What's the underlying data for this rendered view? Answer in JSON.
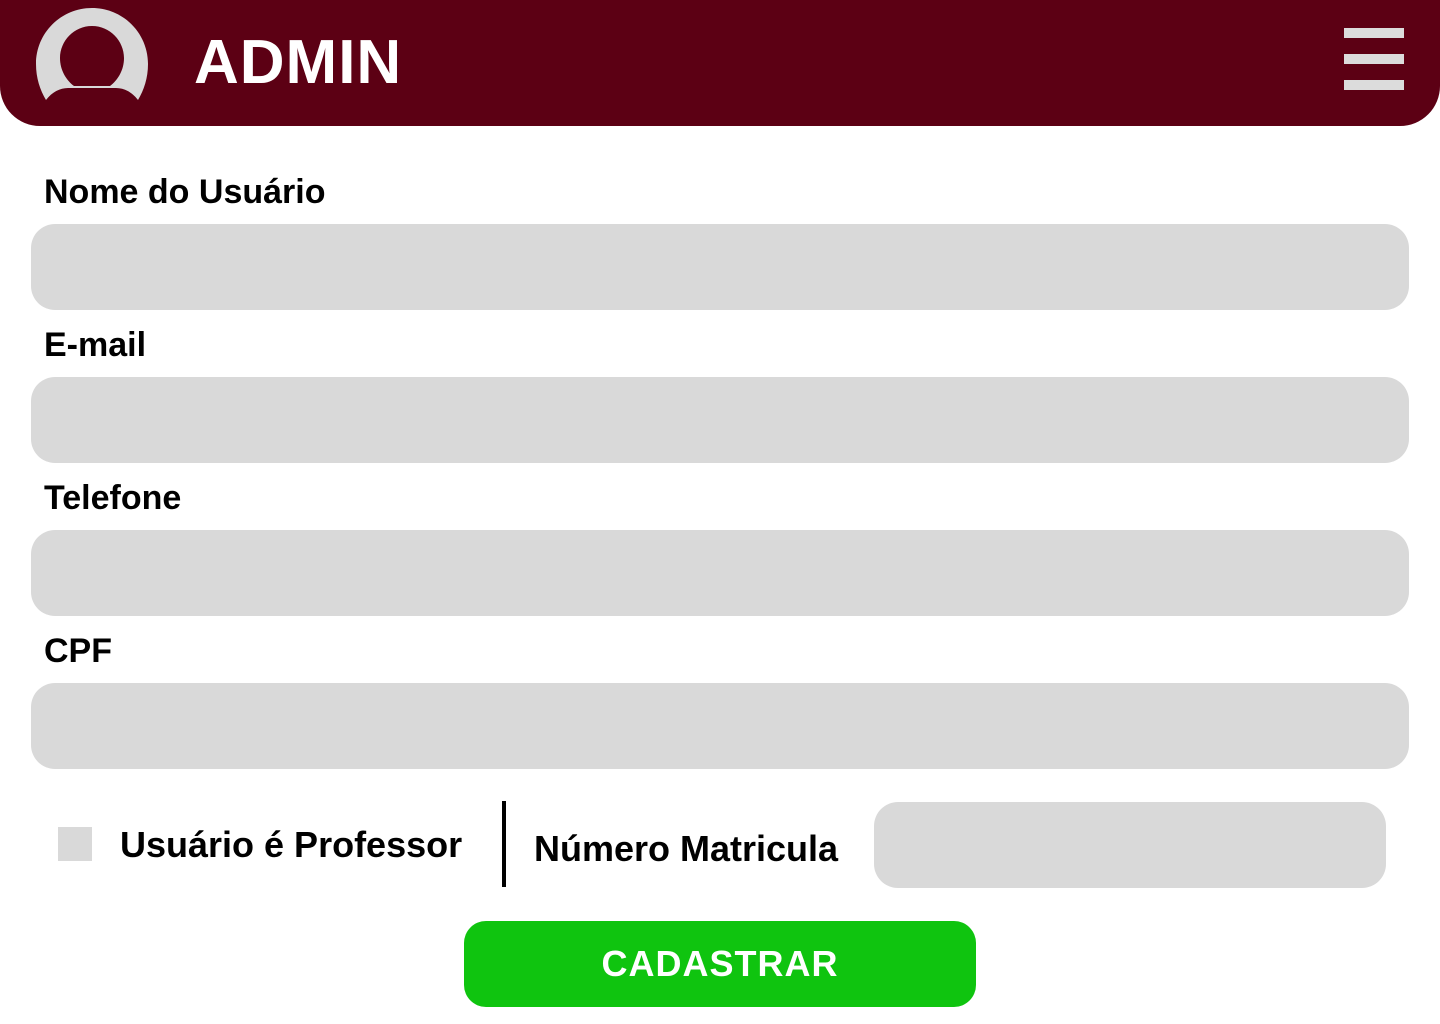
{
  "header": {
    "title": "ADMIN",
    "avatar_icon": "user-avatar-icon",
    "menu_icon": "hamburger-menu-icon",
    "background_color": "#5c0014"
  },
  "form": {
    "fields": [
      {
        "label": "Nome do Usuário",
        "value": "",
        "placeholder": ""
      },
      {
        "label": "E-mail",
        "value": "",
        "placeholder": ""
      },
      {
        "label": "Telefone",
        "value": "",
        "placeholder": ""
      },
      {
        "label": "CPF",
        "value": "",
        "placeholder": ""
      }
    ],
    "professor_checkbox": {
      "label": "Usuário é Professor",
      "checked": false
    },
    "matricula": {
      "label": "Número Matricula",
      "value": ""
    },
    "submit": {
      "label": "CADASTRAR",
      "color": "#0fc40f"
    }
  }
}
